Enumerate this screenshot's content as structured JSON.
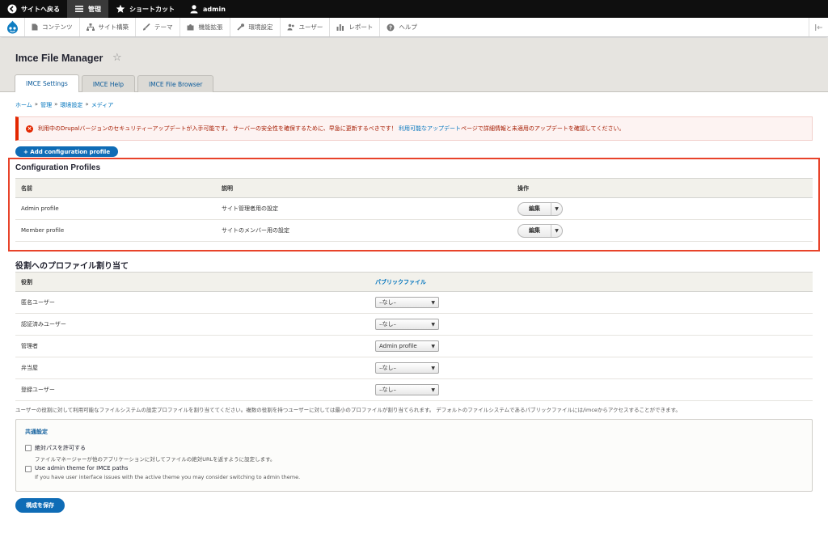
{
  "topbar": {
    "back_label": "サイトへ戻る",
    "manage_label": "管理",
    "shortcuts_label": "ショートカット",
    "user_label": "admin"
  },
  "tray": {
    "items": [
      "コンテンツ",
      "サイト構築",
      "テーマ",
      "機能拡張",
      "環境設定",
      "ユーザー",
      "レポート",
      "ヘルプ"
    ]
  },
  "page": {
    "title": "Imce File Manager",
    "tabs": [
      "IMCE Settings",
      "IMCE Help",
      "IMCE File Browser"
    ]
  },
  "breadcrumb": [
    "ホーム",
    "管理",
    "環境設定",
    "メディア"
  ],
  "breadcrumb_sep": "»",
  "alert": {
    "text_before": "利用中のDrupalバージョンのセキュリティーアップデートが入手可能です。 サーバーの安全性を確保するために、早急に更新するべきです！",
    "link_text": "利用可能なアップデート",
    "text_after": "ページで詳細情報と未適用のアップデートを確認してください。"
  },
  "add_profile_button": "+ Add configuration profile",
  "profiles": {
    "heading": "Configuration Profiles",
    "columns": [
      "名前",
      "説明",
      "操作"
    ],
    "rows": [
      {
        "name": "Admin profile",
        "description": "サイト管理者用の設定",
        "action": "編集"
      },
      {
        "name": "Member profile",
        "description": "サイトのメンバー用の設定",
        "action": "編集"
      }
    ]
  },
  "roles": {
    "heading": "役割へのプロファイル割り当て",
    "columns": [
      "役割",
      "パブリックファイル"
    ],
    "rows": [
      {
        "role": "匿名ユーザー",
        "value": "–なし–"
      },
      {
        "role": "認証済みユーザー",
        "value": "–なし–"
      },
      {
        "role": "管理者",
        "value": "Admin profile"
      },
      {
        "role": "弁当屋",
        "value": "–なし–"
      },
      {
        "role": "登録ユーザー",
        "value": "–なし–"
      }
    ],
    "description": "ユーザーの役割に対して利用可能なファイルシステムの設定プロファイルを割り当ててください。複数の役割を持つユーザーに対しては最小のプロファイルが割り当てられます。 デフォルトのファイルシステムであるパブリックファイルには/imceからアクセスすることができます。"
  },
  "common": {
    "legend": "共通設定",
    "options": [
      {
        "label": "絶対パスを許可する",
        "description": "ファイルマネージャーが他のアプリケーションに対してファイルの絶対URLを返すように設定します。",
        "checked": false
      },
      {
        "label": "Use admin theme for IMCE paths",
        "description": "If you have user interface issues with the active theme you may consider switching to admin theme.",
        "checked": false
      }
    ]
  },
  "save_button": "構成を保存",
  "colors": {
    "accent": "#0f6cb6",
    "error": "#e32700",
    "highlight": "#e8432a"
  }
}
